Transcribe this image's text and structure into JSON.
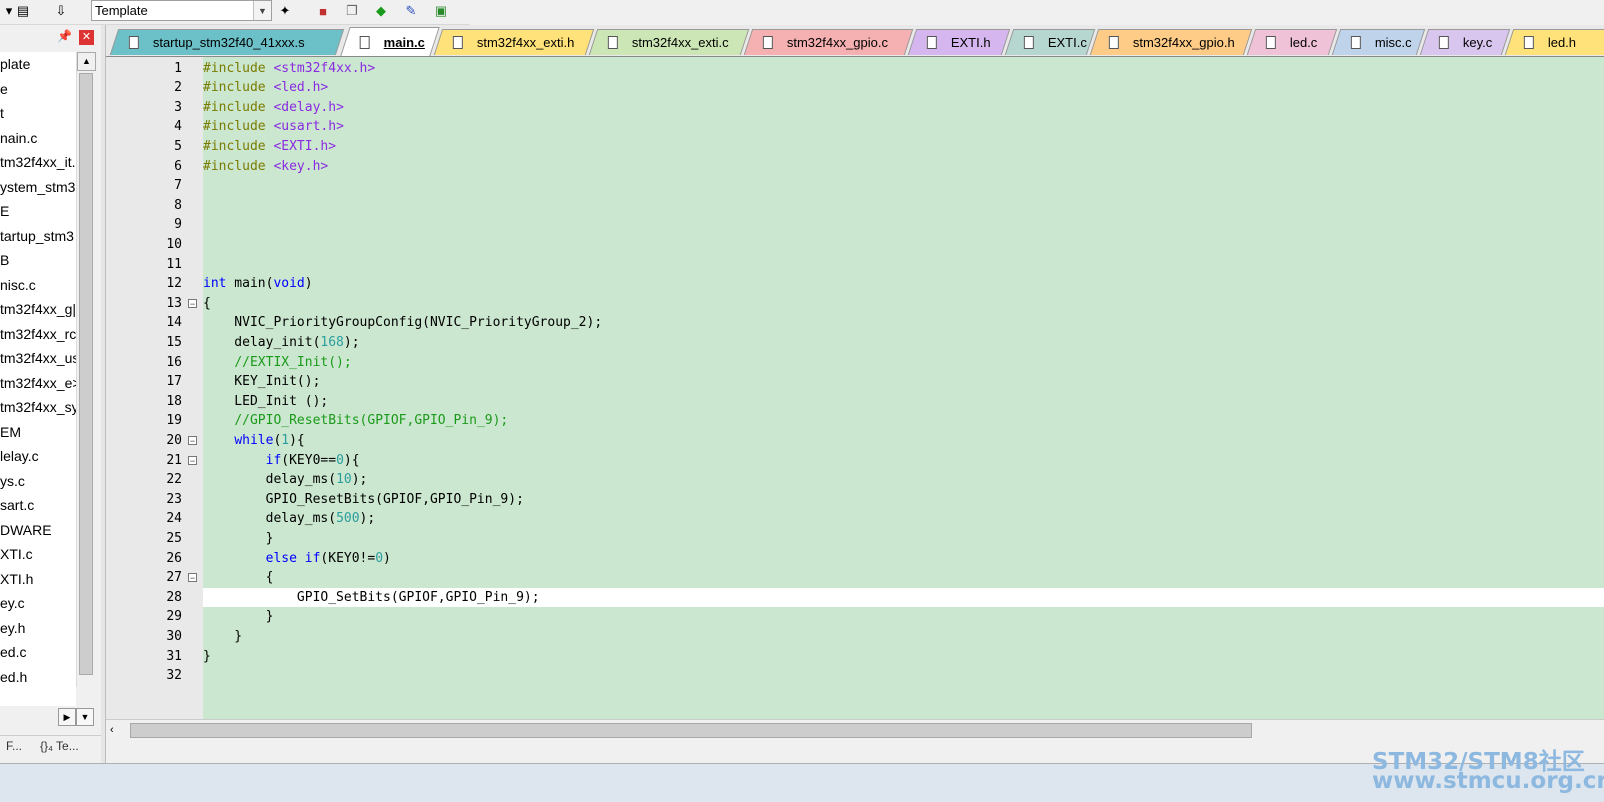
{
  "toolbar": {
    "target_value": "Template",
    "icons": [
      "dropdown-arrow-icon",
      "build-output-icon",
      "load-icon",
      "magic-wand-icon",
      "options-icon",
      "manage-components-icon",
      "pack-installer-icon",
      "diamond-icon",
      "batch-icon"
    ]
  },
  "project_panel": {
    "items": [
      "plate",
      "e",
      "t",
      "nain.c",
      "tm32f4xx_it.",
      "ystem_stm3",
      "E",
      "tartup_stm3",
      "B",
      "nisc.c",
      "tm32f4xx_g|",
      "tm32f4xx_rc",
      "tm32f4xx_us",
      "tm32f4xx_e>",
      "tm32f4xx_sy",
      "EM",
      "lelay.c",
      "ys.c",
      "sart.c",
      "DWARE",
      "XTI.c",
      "XTI.h",
      "ey.c",
      "ey.h",
      "ed.c",
      "ed.h"
    ],
    "tabs": [
      "F...",
      "{}₄ Te..."
    ]
  },
  "tabs": [
    {
      "label": "startup_stm32f40_41xxx.s",
      "color": "#6cc0c8"
    },
    {
      "label": "main.c",
      "color": "#ffffff",
      "active": true
    },
    {
      "label": "stm32f4xx_exti.h",
      "color": "#ffe27a"
    },
    {
      "label": "stm32f4xx_exti.c",
      "color": "#cde6b6"
    },
    {
      "label": "stm32f4xx_gpio.c",
      "color": "#f5b1b1"
    },
    {
      "label": "EXTI.h",
      "color": "#d5b6ee"
    },
    {
      "label": "EXTI.c",
      "color": "#b6d6d0"
    },
    {
      "label": "stm32f4xx_gpio.h",
      "color": "#ffcc88"
    },
    {
      "label": "led.c",
      "color": "#f0c2d8"
    },
    {
      "label": "misc.c",
      "color": "#bfd3ea"
    },
    {
      "label": "key.c",
      "color": "#d9c6ee"
    },
    {
      "label": "led.h",
      "color": "#ffe27a"
    }
  ],
  "code_lines": [
    {
      "n": "1",
      "t": "#include <stm32f4xx.h>"
    },
    {
      "n": "2",
      "t": "#include <led.h>"
    },
    {
      "n": "3",
      "t": "#include <delay.h>"
    },
    {
      "n": "4",
      "t": "#include <usart.h>"
    },
    {
      "n": "5",
      "t": "#include <EXTI.h>"
    },
    {
      "n": "6",
      "t": "#include <key.h>"
    },
    {
      "n": "7",
      "t": ""
    },
    {
      "n": "8",
      "t": ""
    },
    {
      "n": "9",
      "t": ""
    },
    {
      "n": "10",
      "t": ""
    },
    {
      "n": "11",
      "t": ""
    },
    {
      "n": "12",
      "t": "int main(void)"
    },
    {
      "n": "13",
      "t": "{"
    },
    {
      "n": "14",
      "t": "    NVIC_PriorityGroupConfig(NVIC_PriorityGroup_2);"
    },
    {
      "n": "15",
      "t": "    delay_init(168);"
    },
    {
      "n": "16",
      "t": "    //EXTIX_Init();"
    },
    {
      "n": "17",
      "t": "    KEY_Init();"
    },
    {
      "n": "18",
      "t": "    LED_Init ();"
    },
    {
      "n": "19",
      "t": "    //GPIO_ResetBits(GPIOF,GPIO_Pin_9);"
    },
    {
      "n": "20",
      "t": "    while(1){"
    },
    {
      "n": "21",
      "t": "        if(KEY0==0){"
    },
    {
      "n": "22",
      "t": "        delay_ms(10);"
    },
    {
      "n": "23",
      "t": "        GPIO_ResetBits(GPIOF,GPIO_Pin_9);"
    },
    {
      "n": "24",
      "t": "        delay_ms(500);"
    },
    {
      "n": "25",
      "t": "        }"
    },
    {
      "n": "26",
      "t": "        else if(KEY0!=0)"
    },
    {
      "n": "27",
      "t": "        {"
    },
    {
      "n": "28",
      "t": "            GPIO_SetBits(GPIOF,GPIO_Pin_9);"
    },
    {
      "n": "29",
      "t": "        }"
    },
    {
      "n": "30",
      "t": "    }"
    },
    {
      "n": "31",
      "t": "}"
    },
    {
      "n": "32",
      "t": ""
    }
  ],
  "current_line": "28",
  "watermark": {
    "line1": "STM32/STM8社区",
    "line2": "www.stmcu.org.cn"
  }
}
